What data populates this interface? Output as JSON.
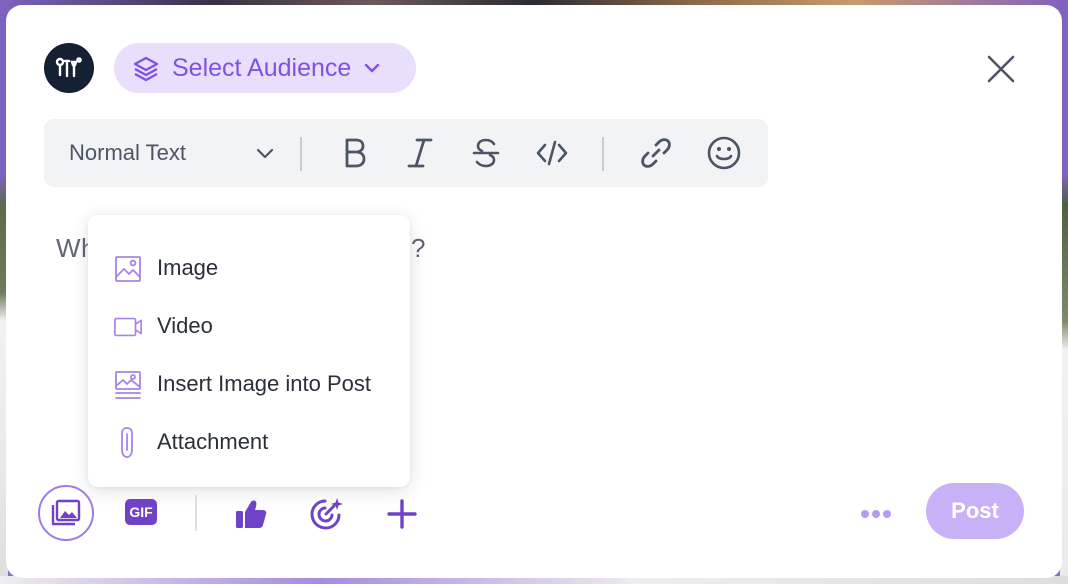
{
  "header": {
    "audience_label": "Select Audience"
  },
  "toolbar": {
    "text_style": "Normal Text"
  },
  "composer": {
    "placeholder_start": "Wh",
    "placeholder_end": "?"
  },
  "attach_menu": {
    "items": [
      {
        "label": "Image",
        "icon": "image-icon"
      },
      {
        "label": "Video",
        "icon": "video-icon"
      },
      {
        "label": "Insert Image into Post",
        "icon": "insert-image-icon"
      },
      {
        "label": "Attachment",
        "icon": "paperclip-icon"
      }
    ]
  },
  "footer": {
    "gif_label": "GIF",
    "post_label": "Post"
  },
  "colors": {
    "accent": "#7f52e2",
    "accent_light": "#e9defb",
    "post_disabled": "#c8b2f7",
    "icon_gray": "#4c5566"
  }
}
